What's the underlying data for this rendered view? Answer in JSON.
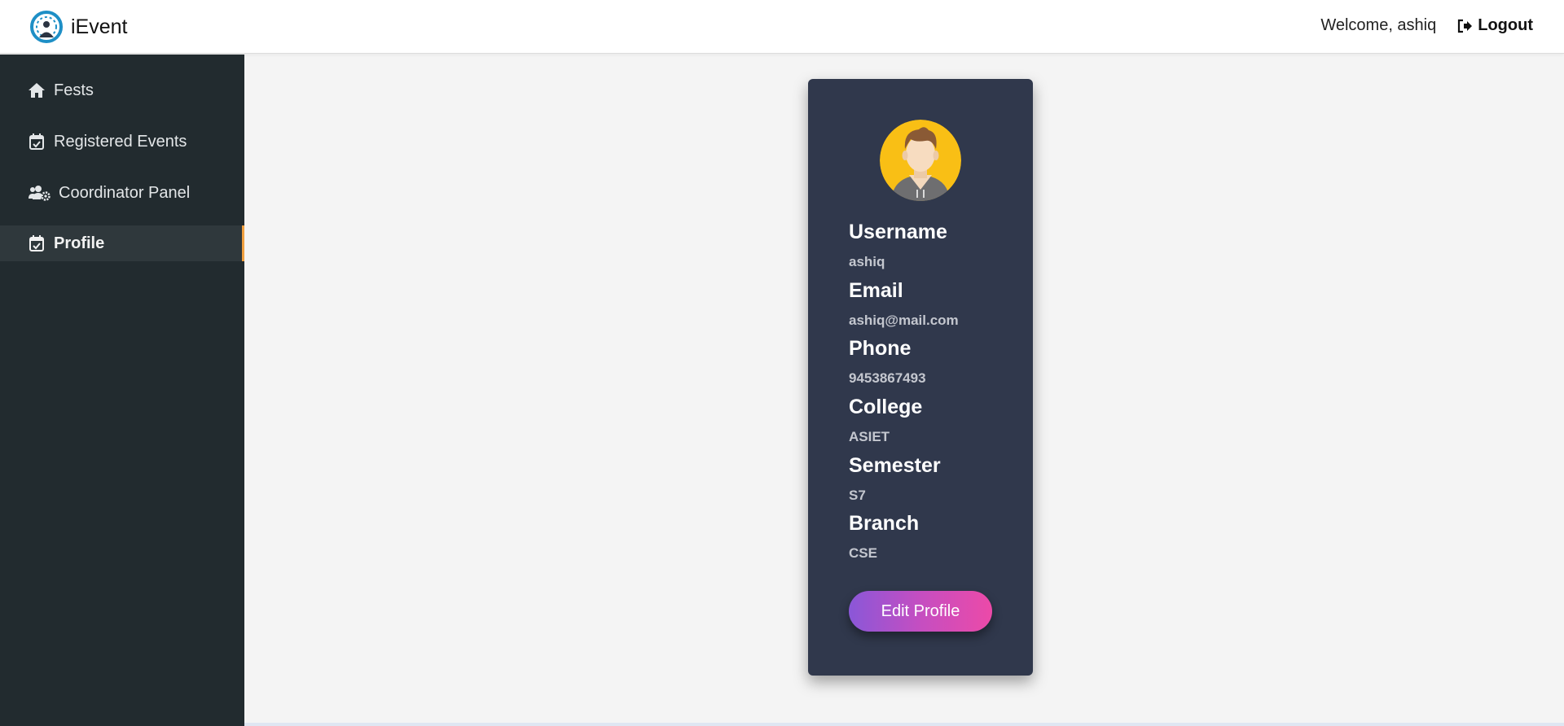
{
  "header": {
    "app_name": "iEvent",
    "logo_icon": "event-gauge-icon",
    "welcome_text": "Welcome, ashiq",
    "logout_label": "Logout"
  },
  "sidebar": {
    "items": [
      {
        "label": "Fests",
        "icon": "home-icon",
        "active": false
      },
      {
        "label": "Registered Events",
        "icon": "calendar-check-icon",
        "active": false
      },
      {
        "label": "Coordinator Panel",
        "icon": "users-cog-icon",
        "active": false
      },
      {
        "label": "Profile",
        "icon": "calendar-check-icon",
        "active": true
      }
    ]
  },
  "profile": {
    "avatar_icon": "user-avatar-icon",
    "fields": [
      {
        "label": "Username",
        "value": "ashiq"
      },
      {
        "label": "Email",
        "value": "ashiq@mail.com"
      },
      {
        "label": "Phone",
        "value": "9453867493"
      },
      {
        "label": "College",
        "value": "ASIET"
      },
      {
        "label": "Semester",
        "value": "S7"
      },
      {
        "label": "Branch",
        "value": "CSE"
      }
    ],
    "edit_label": "Edit Profile"
  },
  "colors": {
    "sidebar_bg": "#222b2f",
    "card_bg": "#30384c",
    "active_accent": "#f0a040",
    "button_gradient_start": "#8a57d8",
    "button_gradient_end": "#ec4aa8"
  }
}
